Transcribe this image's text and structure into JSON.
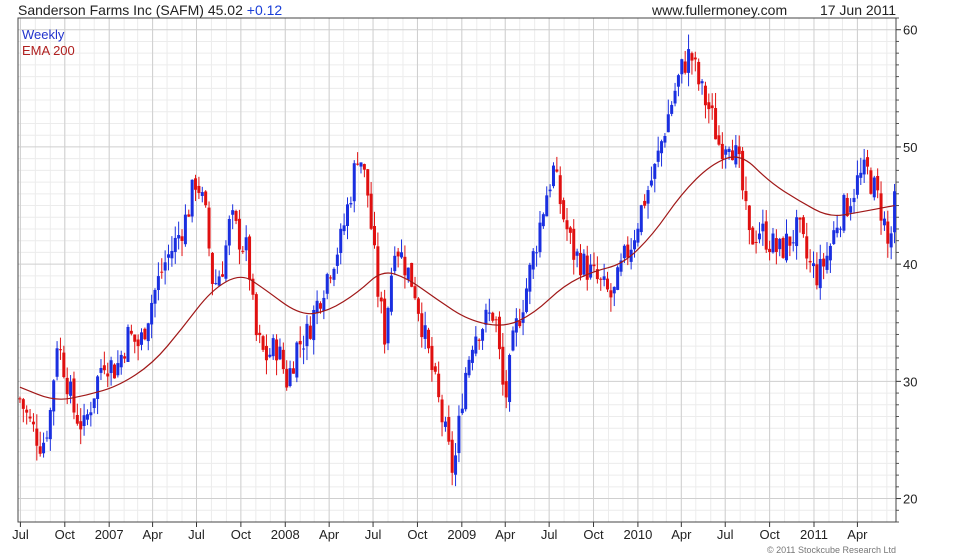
{
  "header": {
    "ticker_name": "Sanderson Farms Inc (SAFM) 45.02",
    "ticker_change": "+0.12",
    "site": "www.fullermoney.com",
    "date": "17 Jun 2011"
  },
  "legend": {
    "weekly": "Weekly",
    "ema": "EMA 200"
  },
  "copyright": "© 2011 Stockcube Research Ltd",
  "colors": {
    "up": "#1a2fe0",
    "down": "#e01010",
    "ema": "#a01818",
    "grid": "#cfcfcf",
    "minor": "#ececec"
  },
  "chart_data": {
    "type": "candlestick",
    "frequency": "Weekly",
    "y_ticks": [
      20,
      30,
      40,
      50,
      60
    ],
    "ylim": [
      18,
      61
    ],
    "x_ticks": [
      "Jul",
      "Oct",
      "2007",
      "Apr",
      "Jul",
      "Oct",
      "2008",
      "Apr",
      "Jul",
      "Oct",
      "2009",
      "Apr",
      "Jul",
      "Oct",
      "2010",
      "Apr",
      "Jul",
      "Oct",
      "2011",
      "Apr"
    ],
    "xlim": [
      "2006-06-26",
      "2011-06-20"
    ],
    "close_path": [
      [
        "2006-06-30",
        28.5
      ],
      [
        "2006-07-20",
        26.5
      ],
      [
        "2006-08-15",
        24.5
      ],
      [
        "2006-08-31",
        27
      ],
      [
        "2006-09-15",
        33.5
      ],
      [
        "2006-10-01",
        31
      ],
      [
        "2006-10-20",
        27.5
      ],
      [
        "2006-11-10",
        26
      ],
      [
        "2006-11-30",
        29
      ],
      [
        "2006-12-20",
        32
      ],
      [
        "2007-01-15",
        31
      ],
      [
        "2007-02-10",
        34
      ],
      [
        "2007-03-05",
        33
      ],
      [
        "2007-03-31",
        37
      ],
      [
        "2007-04-25",
        40
      ],
      [
        "2007-05-20",
        42
      ],
      [
        "2007-06-10",
        44
      ],
      [
        "2007-07-01",
        47.5
      ],
      [
        "2007-07-20",
        44
      ],
      [
        "2007-08-05",
        38
      ],
      [
        "2007-08-25",
        40
      ],
      [
        "2007-09-10",
        44
      ],
      [
        "2007-09-30",
        42
      ],
      [
        "2007-10-15",
        41
      ],
      [
        "2007-10-31",
        34
      ],
      [
        "2007-11-20",
        32
      ],
      [
        "2007-12-15",
        33
      ],
      [
        "2008-01-05",
        30
      ],
      [
        "2008-01-25",
        33
      ],
      [
        "2008-02-15",
        34
      ],
      [
        "2008-03-10",
        37
      ],
      [
        "2008-04-05",
        40
      ],
      [
        "2008-04-25",
        42
      ],
      [
        "2008-05-15",
        46
      ],
      [
        "2008-06-01",
        50
      ],
      [
        "2008-06-20",
        46
      ],
      [
        "2008-07-10",
        38
      ],
      [
        "2008-07-25",
        34
      ],
      [
        "2008-08-15",
        42
      ],
      [
        "2008-09-05",
        40
      ],
      [
        "2008-09-25",
        38
      ],
      [
        "2008-10-15",
        34
      ],
      [
        "2008-11-05",
        30
      ],
      [
        "2008-11-25",
        26
      ],
      [
        "2008-12-15",
        22
      ],
      [
        "2009-01-05",
        30
      ],
      [
        "2009-01-25",
        34
      ],
      [
        "2009-02-15",
        35
      ],
      [
        "2009-03-10",
        36
      ],
      [
        "2009-03-31",
        28
      ],
      [
        "2009-04-20",
        34
      ],
      [
        "2009-05-15",
        38
      ],
      [
        "2009-06-05",
        42
      ],
      [
        "2009-06-25",
        46
      ],
      [
        "2009-07-10",
        48
      ],
      [
        "2009-07-31",
        44
      ],
      [
        "2009-08-20",
        41
      ],
      [
        "2009-09-10",
        40
      ],
      [
        "2009-09-30",
        39
      ],
      [
        "2009-10-20",
        38
      ],
      [
        "2009-11-10",
        37
      ],
      [
        "2009-11-30",
        40
      ],
      [
        "2009-12-20",
        42
      ],
      [
        "2010-01-10",
        45
      ],
      [
        "2010-02-05",
        48
      ],
      [
        "2010-02-28",
        52
      ],
      [
        "2010-03-20",
        55
      ],
      [
        "2010-04-05",
        57
      ],
      [
        "2010-04-20",
        58
      ],
      [
        "2010-05-10",
        55
      ],
      [
        "2010-05-31",
        53
      ],
      [
        "2010-06-20",
        50
      ],
      [
        "2010-07-10",
        51
      ],
      [
        "2010-07-31",
        48
      ],
      [
        "2010-08-20",
        42
      ],
      [
        "2010-09-10",
        43
      ],
      [
        "2010-09-30",
        42
      ],
      [
        "2010-10-20",
        41
      ],
      [
        "2010-11-10",
        42
      ],
      [
        "2010-11-30",
        43
      ],
      [
        "2010-12-20",
        40
      ],
      [
        "2011-01-10",
        39
      ],
      [
        "2011-01-31",
        41
      ],
      [
        "2011-02-20",
        44
      ],
      [
        "2011-03-10",
        45
      ],
      [
        "2011-03-31",
        47
      ],
      [
        "2011-04-20",
        48
      ],
      [
        "2011-05-10",
        46
      ],
      [
        "2011-05-25",
        44
      ],
      [
        "2011-06-05",
        41
      ],
      [
        "2011-06-17",
        45
      ]
    ],
    "ema_path": [
      [
        "2006-06-30",
        29.5
      ],
      [
        "2006-09-10",
        28.3
      ],
      [
        "2006-11-15",
        28.8
      ],
      [
        "2007-01-20",
        29.6
      ],
      [
        "2007-04-01",
        31.5
      ],
      [
        "2007-06-01",
        34.5
      ],
      [
        "2007-08-01",
        37.8
      ],
      [
        "2007-10-01",
        39.2
      ],
      [
        "2007-11-15",
        38.0
      ],
      [
        "2008-02-01",
        35.6
      ],
      [
        "2008-03-31",
        36.0
      ],
      [
        "2008-05-31",
        37.6
      ],
      [
        "2008-07-20",
        39.5
      ],
      [
        "2008-09-10",
        38.8
      ],
      [
        "2008-11-10",
        37.0
      ],
      [
        "2009-01-15",
        35.2
      ],
      [
        "2009-03-31",
        34.6
      ],
      [
        "2009-05-31",
        35.8
      ],
      [
        "2009-08-01",
        38.2
      ],
      [
        "2009-10-01",
        39.4
      ],
      [
        "2009-12-01",
        40.0
      ],
      [
        "2010-02-01",
        42.5
      ],
      [
        "2010-04-01",
        46.0
      ],
      [
        "2010-06-01",
        48.5
      ],
      [
        "2010-08-01",
        49.5
      ],
      [
        "2010-10-01",
        47.0
      ],
      [
        "2010-12-01",
        45.4
      ],
      [
        "2011-02-01",
        44.0
      ],
      [
        "2011-04-01",
        44.4
      ],
      [
        "2011-06-17",
        45.0
      ]
    ]
  }
}
